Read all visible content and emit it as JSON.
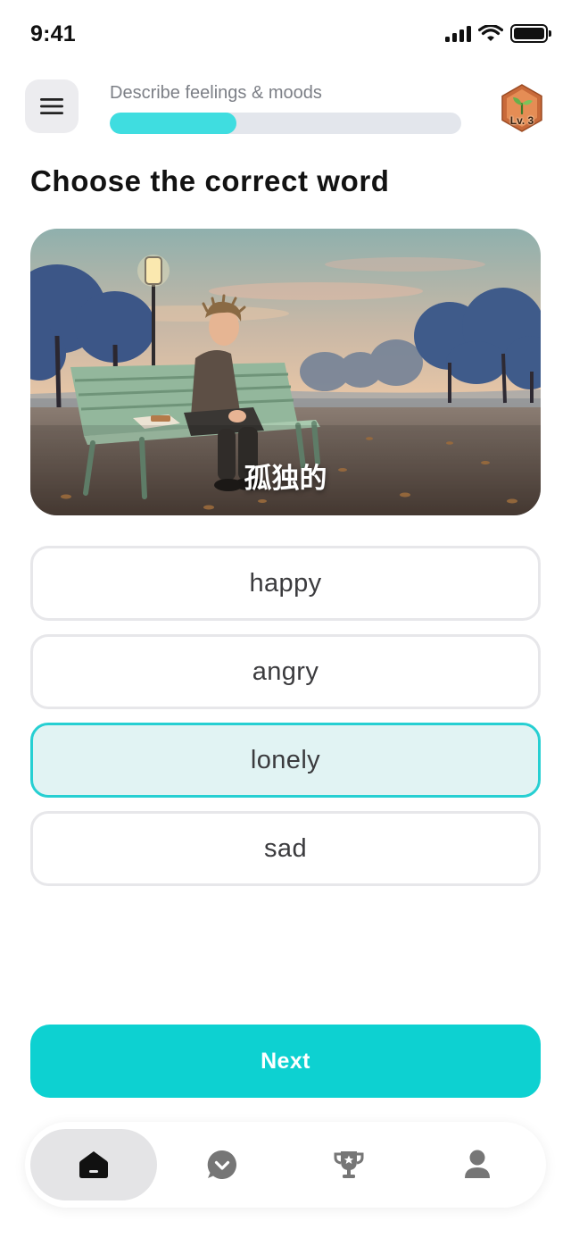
{
  "status_bar": {
    "time": "9:41"
  },
  "header": {
    "lesson_title": "Describe feelings & moods",
    "progress_percent": 36,
    "level_badge": "Lv. 3"
  },
  "question": {
    "prompt": "Choose the correct word"
  },
  "scene": {
    "word": "孤独的"
  },
  "options": [
    {
      "label": "happy",
      "selected": false
    },
    {
      "label": "angry",
      "selected": false
    },
    {
      "label": "lonely",
      "selected": true
    },
    {
      "label": "sad",
      "selected": false
    }
  ],
  "actions": {
    "next_label": "Next"
  },
  "bottom_nav": {
    "items": [
      {
        "icon": "home-icon",
        "active": true
      },
      {
        "icon": "chat-icon",
        "active": false
      },
      {
        "icon": "trophy-icon",
        "active": false
      },
      {
        "icon": "profile-icon",
        "active": false
      }
    ]
  },
  "colors": {
    "accent": "#0dd1d1",
    "progress": "#3fdde0",
    "selected_border": "#26cfd2",
    "selected_fill": "#e1f3f3"
  }
}
